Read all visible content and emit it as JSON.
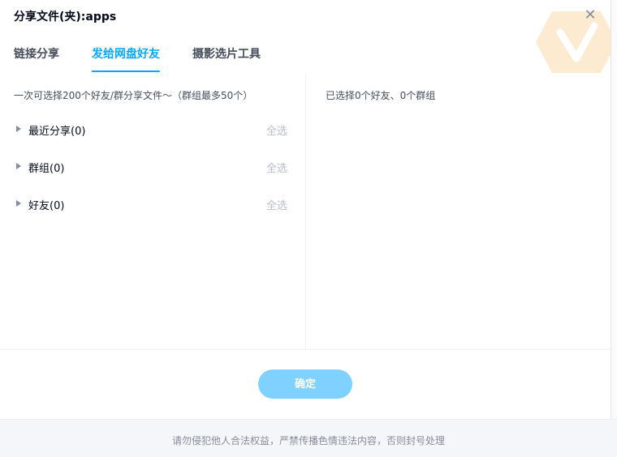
{
  "dialog": {
    "title": "分享文件(夹):apps",
    "close_icon": "close-icon",
    "watermark_icon": "v-logo-icon"
  },
  "tabs": [
    {
      "label": "链接分享",
      "active": false
    },
    {
      "label": "发给网盘好友",
      "active": true
    },
    {
      "label": "摄影选片工具",
      "active": false
    }
  ],
  "left": {
    "hint": "一次可选择200个好友/群分享文件～（群组最多50个）",
    "groups": [
      {
        "label": "最近分享(0)",
        "select_all": "全选"
      },
      {
        "label": "群组(0)",
        "select_all": "全选"
      },
      {
        "label": "好友(0)",
        "select_all": "全选"
      }
    ]
  },
  "right": {
    "selected_text": "已选择0个好友、0个群组"
  },
  "confirm_label": "确定",
  "footer_text": "请勿侵犯他人合法权益，严禁传播色情违法内容，否则封号处理",
  "colors": {
    "accent": "#06a7ff",
    "confirm_bg": "#7fd2ff",
    "muted": "#b8bcc8",
    "watermark": "#f5c27a"
  }
}
